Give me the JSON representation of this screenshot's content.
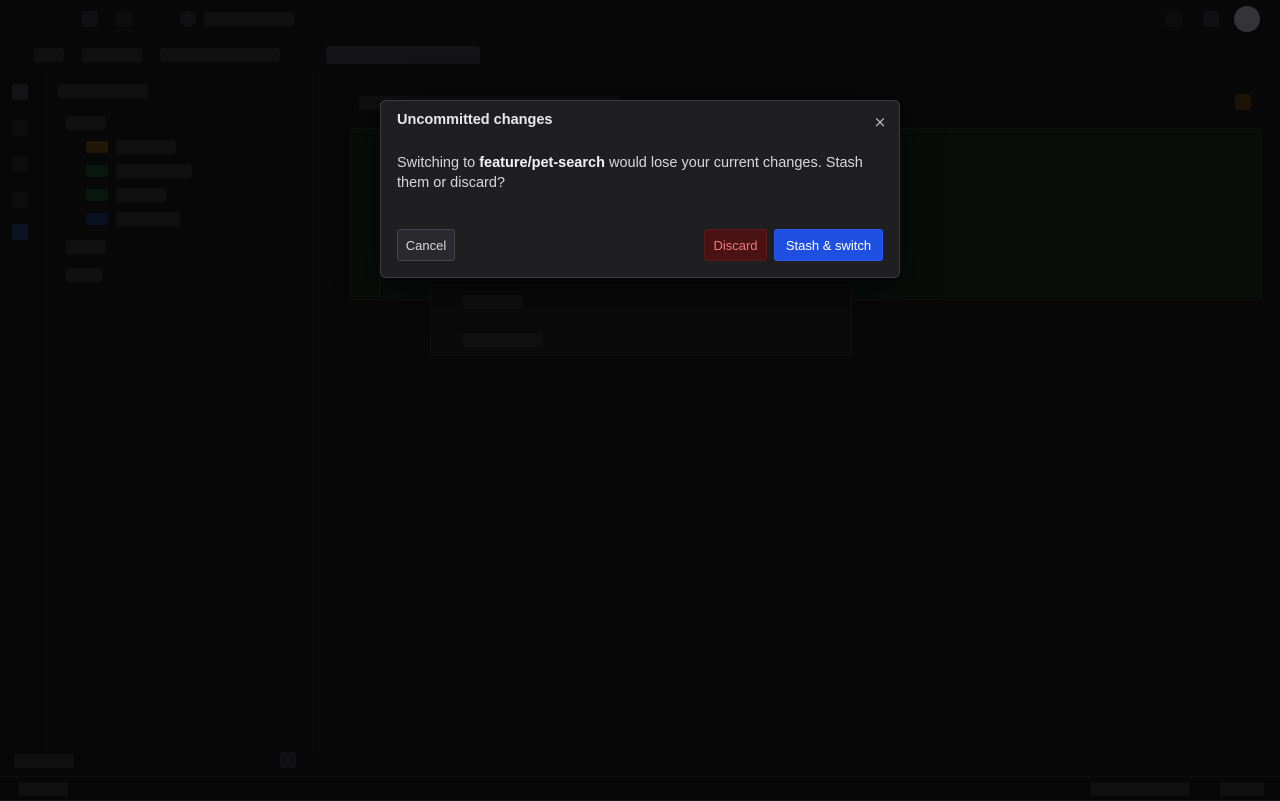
{
  "modal": {
    "title": "Uncommitted changes",
    "close_label": "×",
    "message_prefix": "Switching to ",
    "branch": "feature/pet-search",
    "message_suffix": " would lose your current changes. Stash them or discard?",
    "cancel_label": "Cancel",
    "discard_label": "Discard",
    "stash_label": "Stash & switch"
  },
  "colors": {
    "accent": "#1f4fe0",
    "danger_bg": "#4a1212",
    "danger_text": "#f07a7a"
  },
  "icons": {
    "close": "close-icon",
    "back": "back-icon",
    "forward": "forward-icon",
    "repo": "repo-icon",
    "settings": "gear-icon",
    "notifications": "bell-icon"
  }
}
